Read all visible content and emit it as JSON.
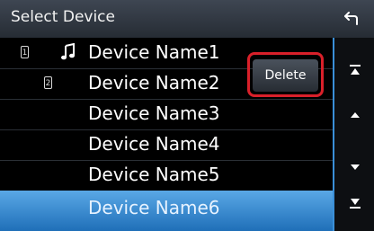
{
  "header": {
    "title": "Select Device"
  },
  "icons": {
    "back": "back-arrow-icon",
    "bluetooth_audio": "music-note-icon"
  },
  "devices": [
    {
      "label": "Device Name1",
      "slot": "1",
      "audio": true
    },
    {
      "label": "Device Name2",
      "slot": "2",
      "audio": false
    },
    {
      "label": "Device Name3"
    },
    {
      "label": "Device Name4"
    },
    {
      "label": "Device Name5"
    },
    {
      "label": "Device Name6",
      "selected": true
    }
  ],
  "actions": {
    "delete_label": "Delete"
  },
  "scroll": {
    "top_icon": "scroll-to-top-icon",
    "up_icon": "scroll-up-icon",
    "down_icon": "scroll-down-icon",
    "bottom_icon": "scroll-to-bottom-icon"
  },
  "colors": {
    "accent": "#3a8fd8",
    "highlight": "#d9202a"
  }
}
